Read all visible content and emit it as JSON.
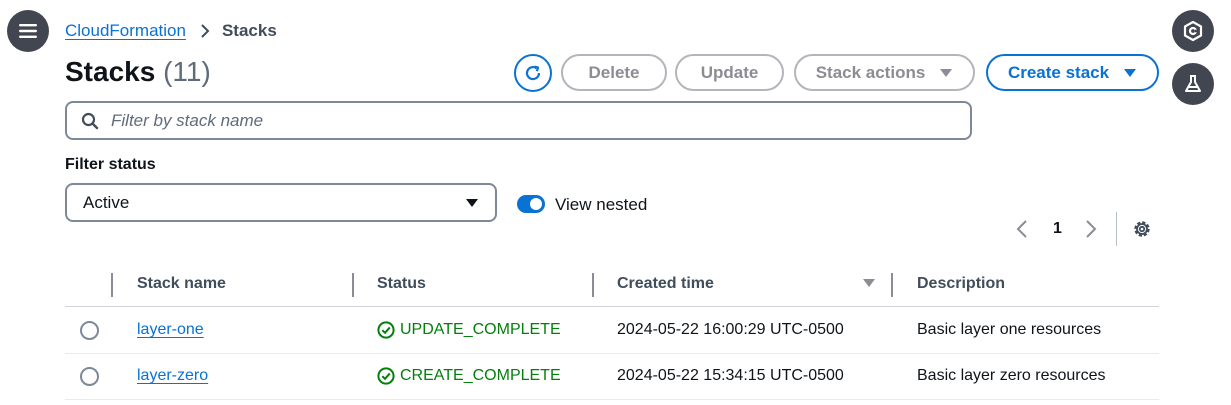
{
  "breadcrumb": {
    "parent": "CloudFormation",
    "current": "Stacks"
  },
  "header": {
    "title": "Stacks",
    "count": "(11)"
  },
  "actions": {
    "delete_label": "Delete",
    "update_label": "Update",
    "stack_actions_label": "Stack actions",
    "create_label": "Create stack"
  },
  "search": {
    "placeholder": "Filter by stack name",
    "value": ""
  },
  "filter": {
    "label": "Filter status",
    "selected": "Active"
  },
  "view_nested": {
    "label": "View nested",
    "enabled": true
  },
  "pagination": {
    "current_page": "1"
  },
  "table": {
    "columns": [
      "Stack name",
      "Status",
      "Created time",
      "Description"
    ],
    "sort_column": "Created time",
    "rows": [
      {
        "name": "layer-one",
        "status": "UPDATE_COMPLETE",
        "created": "2024-05-22 16:00:29 UTC-0500",
        "description": "Basic layer one resources"
      },
      {
        "name": "layer-zero",
        "status": "CREATE_COMPLETE",
        "created": "2024-05-22 15:34:15 UTC-0500",
        "description": "Basic layer zero resources"
      }
    ]
  },
  "icons": {
    "menu": "hamburger-menu-icon",
    "right_top": "shield-gear-icon",
    "right_second": "flask-icon",
    "refresh": "refresh-icon",
    "search": "search-icon",
    "settings": "gear-icon",
    "status_ok": "check-circle-icon"
  },
  "colors": {
    "link": "#0972d3",
    "success": "#037f0c",
    "dark_button": "#424650",
    "disabled_text": "#8c8c94"
  }
}
